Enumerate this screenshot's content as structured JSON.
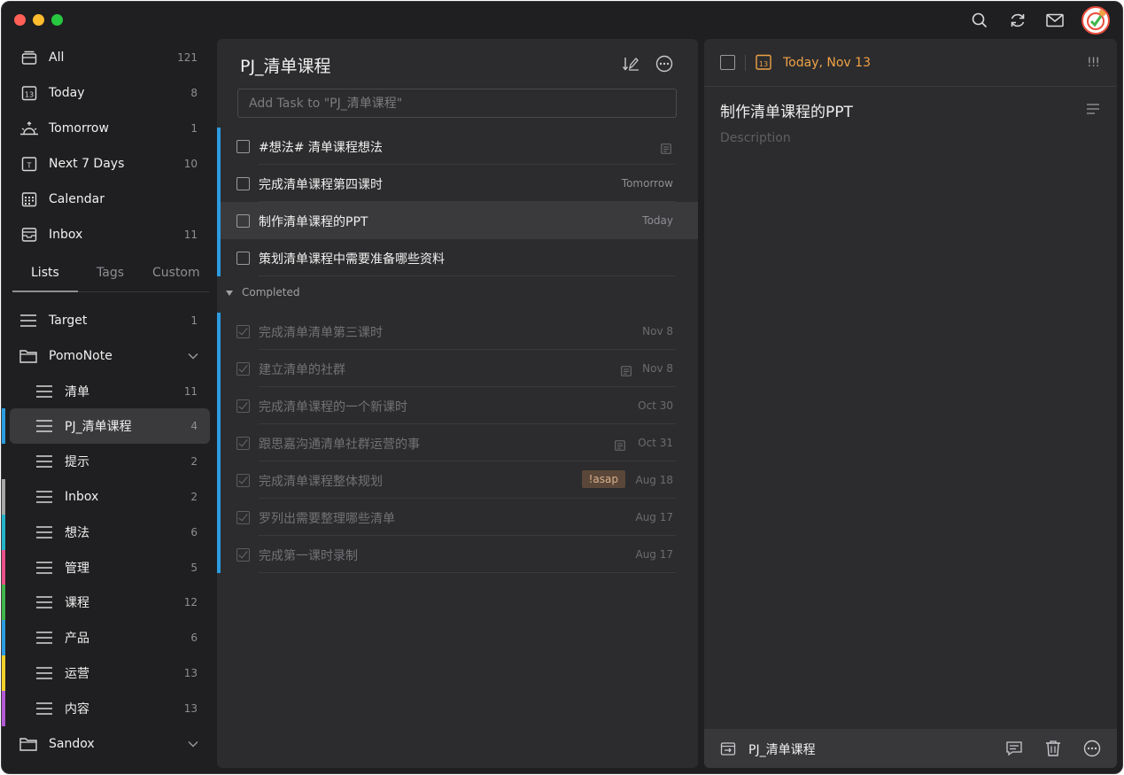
{
  "window": {
    "traffic_lights": {
      "close": "#ff5f57",
      "minimize": "#febc2e",
      "zoom": "#28c840"
    },
    "toolbar_icons": [
      "search-icon",
      "sync-icon",
      "mail-icon"
    ]
  },
  "sidebar": {
    "smart_lists": [
      {
        "label": "All",
        "count": "121",
        "icon": "inbox-stack-icon"
      },
      {
        "label": "Today",
        "count": "8",
        "icon": "calendar-13-icon"
      },
      {
        "label": "Tomorrow",
        "count": "1",
        "icon": "sunrise-icon"
      },
      {
        "label": "Next 7 Days",
        "count": "10",
        "icon": "calendar-t-icon"
      },
      {
        "label": "Calendar",
        "count": "",
        "icon": "calendar-grid-icon"
      },
      {
        "label": "Inbox",
        "count": "11",
        "icon": "tray-icon"
      }
    ],
    "tabs": [
      {
        "label": "Lists",
        "active": true
      },
      {
        "label": "Tags",
        "active": false
      },
      {
        "label": "Custom",
        "active": false
      }
    ],
    "lists": [
      {
        "label": "Target",
        "count": "1",
        "type": "list",
        "indent": false,
        "color": ""
      },
      {
        "label": "PomoNote",
        "count": "",
        "type": "folder",
        "indent": false,
        "color": ""
      },
      {
        "label": "清单",
        "count": "11",
        "type": "list",
        "indent": true,
        "color": ""
      },
      {
        "label": "PJ_清单课程",
        "count": "4",
        "type": "list",
        "indent": true,
        "color": "#2c9ce0",
        "active": true
      },
      {
        "label": "提示",
        "count": "2",
        "type": "list",
        "indent": true,
        "color": ""
      },
      {
        "label": "Inbox",
        "count": "2",
        "type": "list",
        "indent": true,
        "color": "#a8a8a8"
      },
      {
        "label": "想法",
        "count": "6",
        "type": "list",
        "indent": true,
        "color": "#25b3c9"
      },
      {
        "label": "管理",
        "count": "5",
        "type": "list",
        "indent": true,
        "color": "#e8508a"
      },
      {
        "label": "课程",
        "count": "12",
        "type": "list",
        "indent": true,
        "color": "#3fb54a"
      },
      {
        "label": "产品",
        "count": "6",
        "type": "list",
        "indent": true,
        "color": "#2c9ce0"
      },
      {
        "label": "运营",
        "count": "13",
        "type": "list",
        "indent": true,
        "color": "#f0d12a"
      },
      {
        "label": "内容",
        "count": "13",
        "type": "list",
        "indent": true,
        "color": "#b45ad6"
      },
      {
        "label": "Sandox",
        "count": "",
        "type": "folder",
        "indent": false,
        "color": ""
      }
    ]
  },
  "middle": {
    "title": "PJ_清单课程",
    "add_placeholder": "Add Task to \"PJ_清单课程\"",
    "tasks": [
      {
        "title": "#想法# 清单课程想法",
        "date": "",
        "note": true
      },
      {
        "title": "完成清单课程第四课时",
        "date": "Tomorrow",
        "note": false
      },
      {
        "title": "制作清单课程的PPT",
        "date": "Today",
        "note": false,
        "selected": true
      },
      {
        "title": "策划清单课程中需要准备哪些资料",
        "date": "",
        "note": false
      }
    ],
    "completed_label": "Completed",
    "completed": [
      {
        "title": "完成清单清单第三课时",
        "date": "Nov 8",
        "note": false
      },
      {
        "title": "建立清单的社群",
        "date": "Nov 8",
        "note": true
      },
      {
        "title": "完成清单课程的一个新课时",
        "date": "Oct 30",
        "note": false
      },
      {
        "title": "跟思嘉沟通清单社群运营的事",
        "date": "Oct 31",
        "note": true
      },
      {
        "title": "完成清单课程整体规划",
        "date": "Aug 18",
        "note": false,
        "tag": "!asap"
      },
      {
        "title": "罗列出需要整理哪些清单",
        "date": "Aug 17",
        "note": false
      },
      {
        "title": "完成第一课时录制",
        "date": "Aug 17",
        "note": false
      }
    ]
  },
  "detail": {
    "date_label": "Today, Nov 13",
    "calendar_day": "13",
    "priority": "!!!",
    "title": "制作清单课程的PPT",
    "description_placeholder": "Description",
    "list_name": "PJ_清单课程",
    "accent_color": "#f0a246"
  }
}
